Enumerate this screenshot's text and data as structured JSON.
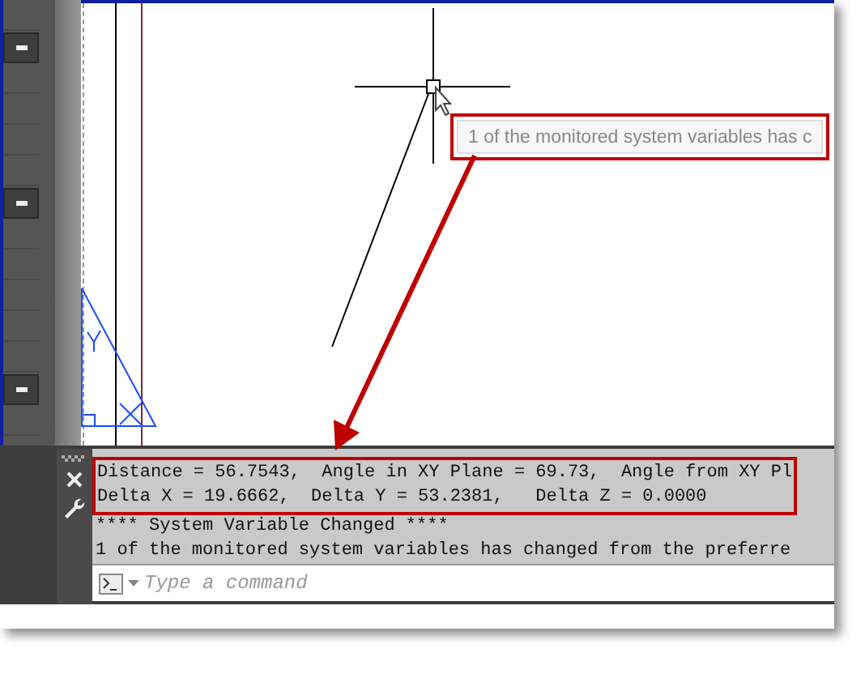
{
  "drawing": {
    "tooltip": {
      "text": "1 of the monitored system variables has c",
      "highlighted": true
    }
  },
  "command_line": {
    "history": [
      {
        "text": "Distance = 56.7543,  Angle in XY Plane = 69.73,  Angle from XY Pl",
        "highlighted": true
      },
      {
        "text": "Delta X = 19.6662,  Delta Y = 53.2381,   Delta Z = 0.0000",
        "highlighted": true
      },
      {
        "text": "**** System Variable Changed ****",
        "highlighted": false
      },
      {
        "text": "1 of the monitored system variables has changed from the preferre",
        "highlighted": false
      }
    ],
    "input": {
      "placeholder": "Type a command"
    }
  }
}
